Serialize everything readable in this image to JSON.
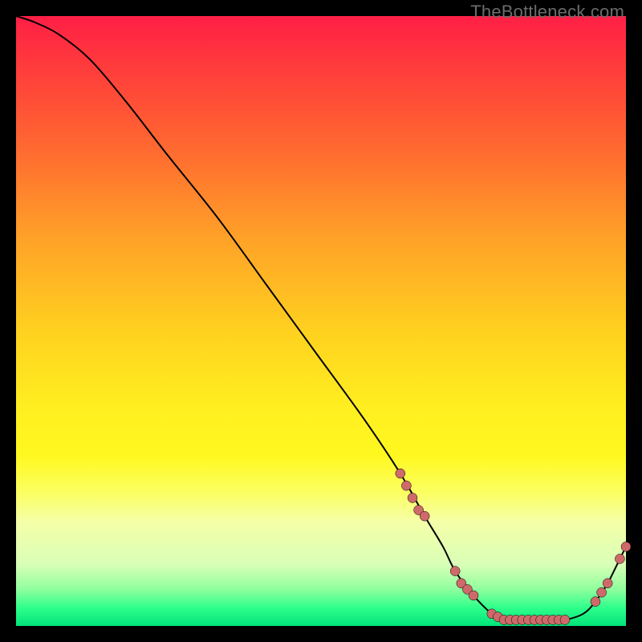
{
  "watermark": {
    "text": "TheBottleneck.com"
  },
  "colors": {
    "line": "#000000",
    "marker_fill": "#cf6a6a",
    "marker_stroke": "#000000"
  },
  "chart_data": {
    "type": "line",
    "title": "",
    "xlabel": "",
    "ylabel": "",
    "xlim": [
      0,
      100
    ],
    "ylim": [
      0,
      100
    ],
    "grid": false,
    "legend": false,
    "series": [
      {
        "name": "curve",
        "x": [
          0,
          3,
          7,
          12,
          18,
          25,
          33,
          41,
          49,
          57,
          63,
          67,
          70,
          72,
          75,
          78,
          80,
          82,
          84,
          86,
          88,
          90,
          93,
          95,
          97,
          99,
          100
        ],
        "y": [
          100,
          99,
          97,
          93,
          86,
          77,
          67,
          56,
          45,
          34,
          25,
          18,
          13,
          9,
          5,
          2,
          1,
          1,
          1,
          1,
          1,
          1,
          2,
          4,
          7,
          11,
          13
        ]
      }
    ],
    "markers": [
      {
        "name": "descent-cluster",
        "points": [
          {
            "x": 63,
            "y": 25
          },
          {
            "x": 64,
            "y": 23
          },
          {
            "x": 65,
            "y": 21
          },
          {
            "x": 66,
            "y": 19
          },
          {
            "x": 67,
            "y": 18
          }
        ]
      },
      {
        "name": "elbow-cluster",
        "points": [
          {
            "x": 72,
            "y": 9
          },
          {
            "x": 73,
            "y": 7
          },
          {
            "x": 74,
            "y": 6
          },
          {
            "x": 75,
            "y": 5
          }
        ]
      },
      {
        "name": "valley-floor",
        "points": [
          {
            "x": 78,
            "y": 2
          },
          {
            "x": 79,
            "y": 1.5
          },
          {
            "x": 80,
            "y": 1
          },
          {
            "x": 81,
            "y": 1
          },
          {
            "x": 82,
            "y": 1
          },
          {
            "x": 83,
            "y": 1
          },
          {
            "x": 84,
            "y": 1
          },
          {
            "x": 85,
            "y": 1
          },
          {
            "x": 86,
            "y": 1
          },
          {
            "x": 87,
            "y": 1
          },
          {
            "x": 88,
            "y": 1
          },
          {
            "x": 89,
            "y": 1
          },
          {
            "x": 90,
            "y": 1
          }
        ]
      },
      {
        "name": "rising-tail",
        "points": [
          {
            "x": 95,
            "y": 4
          },
          {
            "x": 96,
            "y": 5.5
          },
          {
            "x": 97,
            "y": 7
          },
          {
            "x": 99,
            "y": 11
          },
          {
            "x": 100,
            "y": 13
          }
        ]
      }
    ]
  }
}
